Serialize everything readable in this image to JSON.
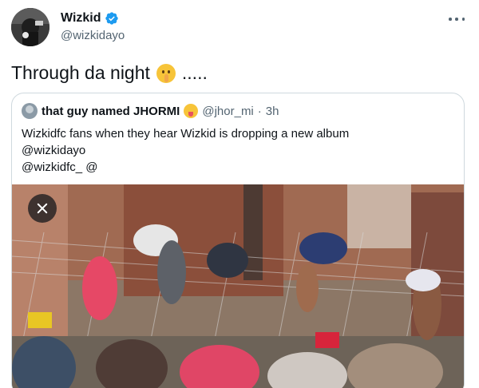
{
  "tweet": {
    "author": {
      "display_name": "Wizkid",
      "handle": "@wizkidayo",
      "avatar_icon": "avatar-photo",
      "verified_icon": "verified-badge-icon",
      "verified_color": "#1d9bf0"
    },
    "more_icon": "more-icon",
    "text": "Through da night",
    "text_emoji": "shushing-face-emoji",
    "text_suffix": "....."
  },
  "quote": {
    "author": {
      "display_name": "that guy named JHORMI",
      "emoji": "tongue-face-emoji",
      "handle": "@jhor_mi",
      "separator": "·",
      "time": "3h"
    },
    "lines": [
      "Wizkidfc fans when they hear Wizkid is dropping a new album",
      "@wizkidayo",
      "@wizkidfc_ @"
    ],
    "media": {
      "description_icon": "crowd-climbing-fence-photo",
      "close_icon": "close-icon"
    }
  },
  "colors": {
    "text_primary": "#0f1419",
    "text_secondary": "#536471",
    "border": "#cfd9de",
    "accent": "#1d9bf0"
  }
}
